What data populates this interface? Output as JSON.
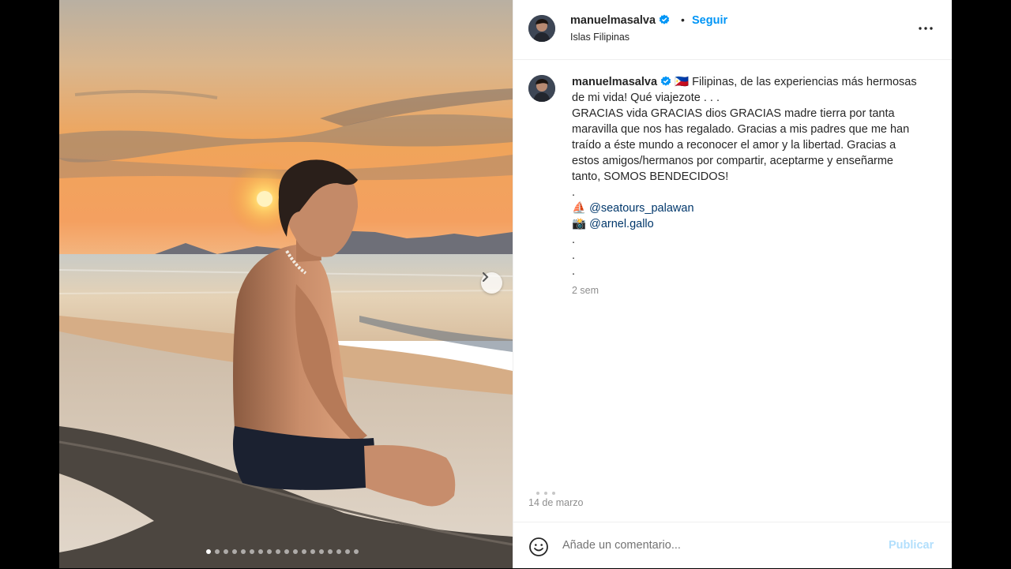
{
  "post": {
    "username": "manuelmasalva",
    "separator": "•",
    "follow_label": "Seguir",
    "location": "Islas Filipinas",
    "caption_lines": [
      "🇵🇭 Filipinas, de las experiencias más hermosas de mi vida! Qué viajezote . . .",
      "GRACIAS vida GRACIAS dios GRACIAS madre tierra por tanta maravilla que nos has regalado. Gracias a mis padres que me han traído a éste mundo a reconocer el amor y la libertad. Gracias a estos amigos/hermanos por compartir, aceptarme y enseñarme tanto, SOMOS BENDECIDOS!",
      "."
    ],
    "mention_1_emoji": "⛵",
    "mention_1": "@seatours_palawan",
    "mention_2_emoji": "📸",
    "mention_2": "@arnel.gallo",
    "trailing_dots": [
      ".",
      ".",
      "."
    ],
    "time_ago": "2 sem",
    "date": "14 de marzo"
  },
  "carousel": {
    "slide_count": 18,
    "active_index": 0
  },
  "comment": {
    "placeholder": "Añade un comentario...",
    "publish_label": "Publicar"
  },
  "colors": {
    "accent": "#0095f6",
    "verified": "#0095f6",
    "publish_disabled": "#b2dffc",
    "text": "#262626",
    "muted": "#8e8e8e",
    "mention": "#00376b"
  },
  "icons": {
    "verified": "verified-badge-icon",
    "more": "more-options-icon",
    "next": "chevron-right-icon",
    "emoji": "emoji-smiley-icon"
  }
}
